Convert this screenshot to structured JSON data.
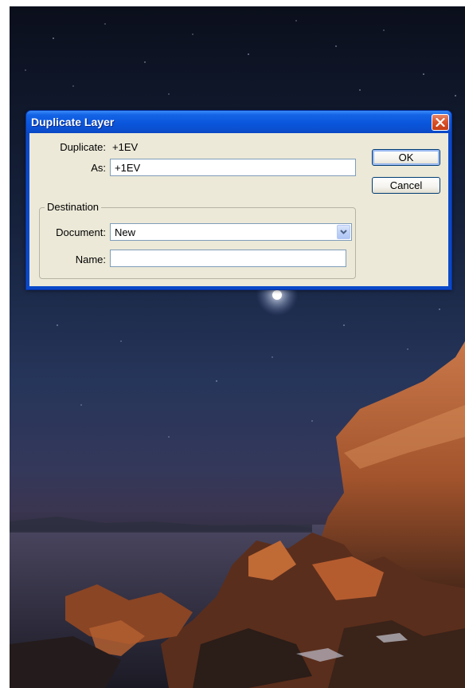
{
  "dialog": {
    "title": "Duplicate Layer",
    "duplicate_label": "Duplicate:",
    "duplicate_value": "+1EV",
    "as_label": "As:",
    "as_value": "+1EV",
    "destination_label": "Destination",
    "document_label": "Document:",
    "document_value": "New",
    "name_label": "Name:",
    "name_value": "",
    "ok_label": "OK",
    "cancel_label": "Cancel"
  },
  "icons": {
    "close": "close-icon",
    "dropdown": "chevron-down-icon"
  },
  "colors": {
    "titlebar": "#0a56dc",
    "dialog_body": "#ece9d8",
    "close_button": "#d9532b"
  }
}
